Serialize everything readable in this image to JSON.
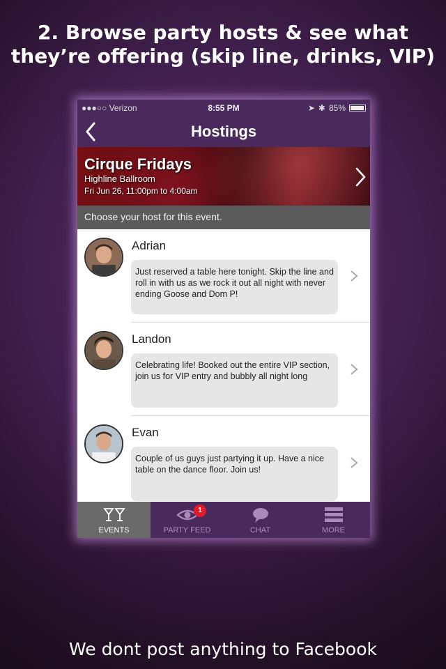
{
  "headline": {
    "line1": "2. Browse party hosts & see what",
    "line2": "they’re offering (skip line, drinks, VIP)"
  },
  "footer_text": "We dont post anything to Facebook",
  "statusbar": {
    "carrier": "●●●○○ Verizon",
    "time": "8:55 PM",
    "battery": "85%",
    "battery_level": 0.85
  },
  "navbar": {
    "title": "Hostings"
  },
  "event": {
    "name": "Cirque Fridays",
    "venue": "Highline Ballroom",
    "datetime": "Fri Jun 26, 11:00pm to 4:00am"
  },
  "choose_prompt": "Choose your host for this event.",
  "hosts": [
    {
      "name": "Adrian",
      "message": "Just reserved a table here tonight. Skip the line and roll in with us as we rock it out all night with never ending Goose and Dom P!"
    },
    {
      "name": "Landon",
      "message": "Celebrating life! Booked out the entire VIP section, join us for VIP entry and bubbly all night long"
    },
    {
      "name": "Evan",
      "message": "Couple of us guys just partying it up. Have a nice table on the dance floor. Join us!"
    }
  ],
  "tabs": [
    {
      "label": "EVENTS",
      "icon": "cocktail-glasses-icon",
      "active": true
    },
    {
      "label": "PARTY FEED",
      "icon": "eye-icon",
      "badge": "1"
    },
    {
      "label": "CHAT",
      "icon": "chat-bubble-icon"
    },
    {
      "label": "MORE",
      "icon": "menu-icon"
    }
  ],
  "colors": {
    "brand_purple": "#4a2a5c",
    "active_tab": "#6a6a6a",
    "badge_red": "#e21a2a"
  }
}
